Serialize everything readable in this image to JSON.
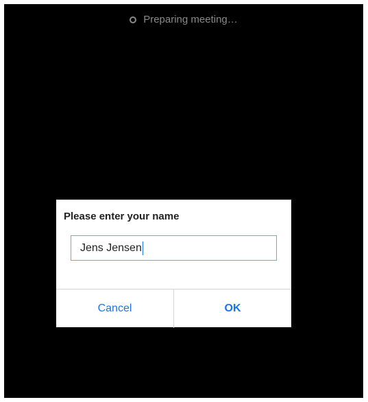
{
  "status": {
    "text": "Preparing meeting…",
    "icon": "spinner-icon"
  },
  "dialog": {
    "title": "Please enter your name",
    "input": {
      "value": "Jens Jensen"
    },
    "cancel_label": "Cancel",
    "ok_label": "OK"
  },
  "colors": {
    "background": "#000000",
    "accent": "#1a73e8",
    "dialog_bg": "#ffffff",
    "status_text": "#8a8a8a"
  }
}
